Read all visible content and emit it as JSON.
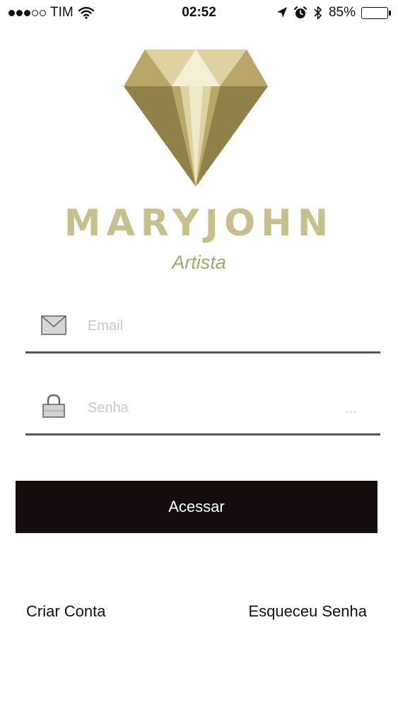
{
  "status_bar": {
    "carrier": "TIM",
    "time": "02:52",
    "battery_percent": "85%",
    "battery_level": 0.85,
    "signal_bars_filled": 3,
    "signal_bars_total": 5,
    "icons": [
      "wifi-icon",
      "location-arrow-icon",
      "alarm-icon",
      "bluetooth-icon",
      "battery-icon"
    ]
  },
  "brand": {
    "name": "MARYJOHN",
    "subtitle": "Artista",
    "colors": {
      "gold_dark": "#8f8149",
      "gold_mid": "#b8a767",
      "gold_light": "#ddd3a1",
      "gold_pale": "#efe9c8",
      "wordmark": "#c9bf8c",
      "subtitle": "#9bab68"
    }
  },
  "login_form": {
    "email": {
      "placeholder": "Email",
      "value": "",
      "icon": "envelope-icon"
    },
    "password": {
      "placeholder": "Senha",
      "value": "",
      "icon": "lock-icon",
      "mask_indicator": "..."
    },
    "submit_label": "Acessar",
    "button_color": "#140c0d"
  },
  "links": {
    "create_account": "Criar Conta",
    "forgot_password": "Esqueceu Senha"
  }
}
